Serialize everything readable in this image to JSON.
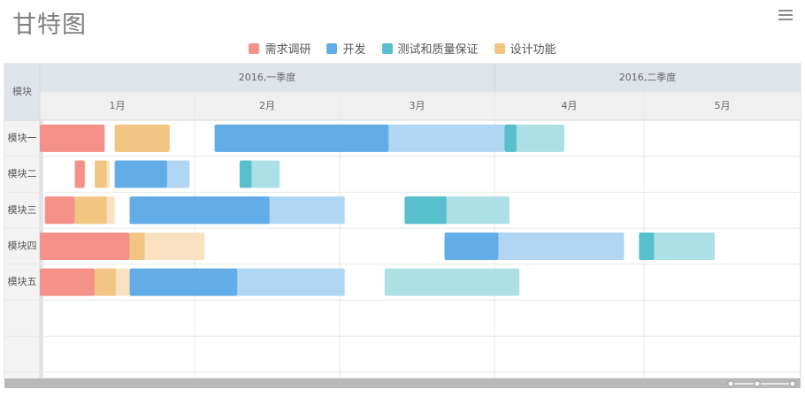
{
  "title": "甘特图",
  "legend": [
    {
      "name": "需求调研",
      "color": "#f4928a"
    },
    {
      "name": "开发",
      "color": "#62ade7"
    },
    {
      "name": "测试和质量保证",
      "color": "#58bfcc"
    },
    {
      "name": "设计功能",
      "color": "#f2c583"
    }
  ],
  "chart_data": {
    "type": "gantt",
    "corner_label": "模块",
    "quarters": [
      "2016,一季度",
      "2016,二季度"
    ],
    "months": [
      "1月",
      "2月",
      "3月",
      "4月",
      "5月"
    ],
    "rows": [
      "模块一",
      "模块二",
      "模块三",
      "模块四",
      "模块五",
      "",
      "",
      ""
    ],
    "tasks": [
      {
        "row": 0,
        "series": "需求调研",
        "start": "2016-01-01",
        "end": "2016-01-14",
        "progress": 1.0
      },
      {
        "row": 0,
        "series": "设计功能",
        "start": "2016-01-16",
        "end": "2016-01-27",
        "progress": 1.0
      },
      {
        "row": 0,
        "series": "开发",
        "start": "2016-02-05",
        "end": "2016-04-03",
        "progress": 0.6
      },
      {
        "row": 0,
        "series": "测试和质量保证",
        "start": "2016-04-03",
        "end": "2016-04-15",
        "progress": 0.2
      },
      {
        "row": 1,
        "series": "需求调研",
        "start": "2016-01-08",
        "end": "2016-01-10",
        "progress": 1.0
      },
      {
        "row": 1,
        "series": "设计功能",
        "start": "2016-01-12",
        "end": "2016-01-15",
        "progress": 0.8
      },
      {
        "row": 1,
        "series": "开发",
        "start": "2016-01-16",
        "end": "2016-01-31",
        "progress": 0.7
      },
      {
        "row": 1,
        "series": "测试和质量保证",
        "start": "2016-02-10",
        "end": "2016-02-18",
        "progress": 0.3
      },
      {
        "row": 2,
        "series": "需求调研",
        "start": "2016-01-02",
        "end": "2016-01-08",
        "progress": 1.0
      },
      {
        "row": 2,
        "series": "设计功能",
        "start": "2016-01-08",
        "end": "2016-01-16",
        "progress": 0.8
      },
      {
        "row": 2,
        "series": "开发",
        "start": "2016-01-19",
        "end": "2016-03-02",
        "progress": 0.65
      },
      {
        "row": 2,
        "series": "测试和质量保证",
        "start": "2016-03-14",
        "end": "2016-04-04",
        "progress": 0.4
      },
      {
        "row": 3,
        "series": "需求调研",
        "start": "2016-01-01",
        "end": "2016-01-19",
        "progress": 1.0
      },
      {
        "row": 3,
        "series": "设计功能",
        "start": "2016-01-19",
        "end": "2016-02-03",
        "progress": 0.2
      },
      {
        "row": 3,
        "series": "开发",
        "start": "2016-03-22",
        "end": "2016-04-27",
        "progress": 0.3
      },
      {
        "row": 3,
        "series": "测试和质量保证",
        "start": "2016-04-30",
        "end": "2016-05-15",
        "progress": 0.2
      },
      {
        "row": 4,
        "series": "需求调研",
        "start": "2016-01-01",
        "end": "2016-01-12",
        "progress": 1.0
      },
      {
        "row": 4,
        "series": "设计功能",
        "start": "2016-01-12",
        "end": "2016-01-19",
        "progress": 0.6
      },
      {
        "row": 4,
        "series": "开发",
        "start": "2016-01-19",
        "end": "2016-03-02",
        "progress": 0.5
      },
      {
        "row": 4,
        "series": "测试和质量保证",
        "start": "2016-03-10",
        "end": "2016-04-06",
        "progress": 0.0
      }
    ]
  }
}
